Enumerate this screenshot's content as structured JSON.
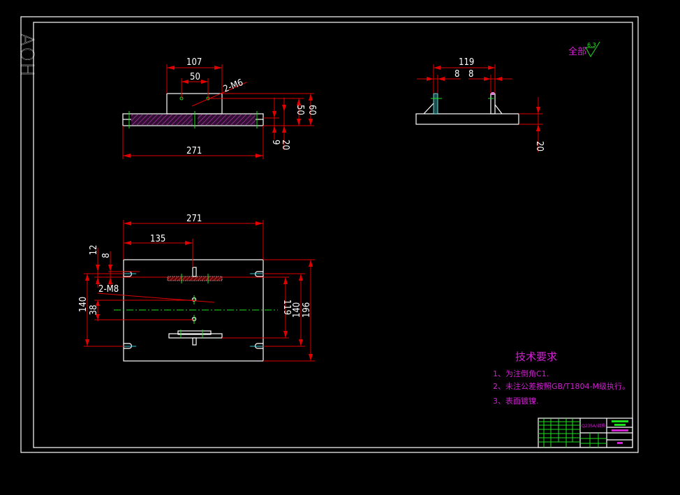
{
  "drawing": {
    "side_label": "AOH",
    "roughness": {
      "prefix": "全部",
      "value": "6.3"
    },
    "front_view": {
      "dims": {
        "top_width": "107",
        "hole_spacing": "50",
        "thread": "2-M6",
        "h50": "50",
        "h60": "60",
        "h9": "9",
        "h20": "20",
        "length": "271"
      }
    },
    "side_view": {
      "dims": {
        "span": "119",
        "left": "8",
        "right": "8",
        "h20": "20"
      }
    },
    "plan_view": {
      "dims": {
        "length": "271",
        "half": "135",
        "d12": "12",
        "d8": "8",
        "thread": "2-M8",
        "left140": "140",
        "d38": "38",
        "d119": "119",
        "right140": "140",
        "d196": "196"
      }
    },
    "tech_requirements": {
      "title": "技术要求",
      "items": [
        "1、为注倒角C1.",
        "2、未注公差按照GB/T1804-M级执行。",
        "3、表面镀镍."
      ]
    },
    "title_block": {
      "material": "Q235A/调质"
    },
    "colors": {
      "outline": "#ffffff",
      "dimension": "#e00000",
      "centerline": "#1ee01e",
      "text_annotation": "#d020d0",
      "hatch": "#a020a0"
    }
  }
}
